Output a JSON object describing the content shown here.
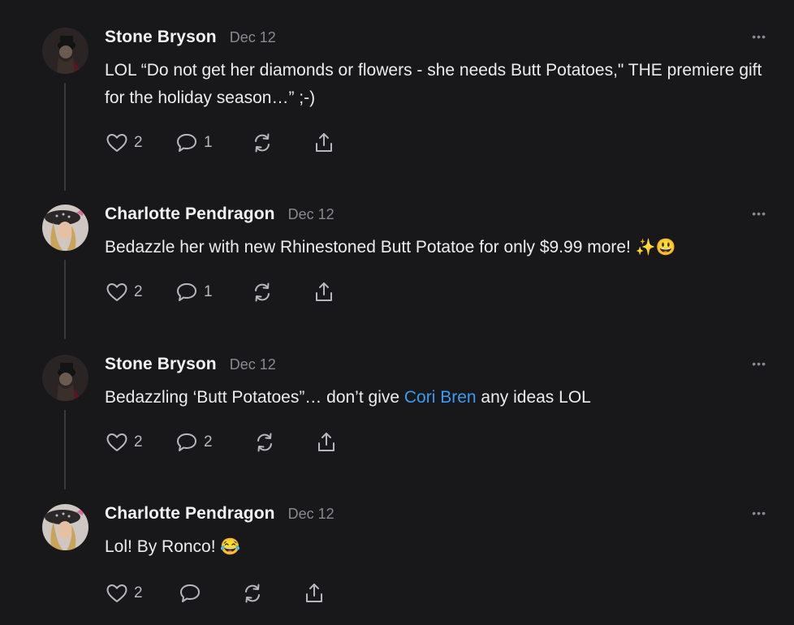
{
  "comments": [
    {
      "author": "Stone Bryson",
      "date": "Dec 12",
      "more": "•••",
      "text": "LOL “Do not get her diamonds or flowers - she needs Butt Potatoes,\" THE premiere gift for the holiday season…” ;-)",
      "likes": "2",
      "replies": "1"
    },
    {
      "author": "Charlotte Pendragon",
      "date": "Dec 12",
      "more": "•••",
      "text": "Bedazzle her with new Rhinestoned Butt Potatoe for only $9.99 more!",
      "emoji": "✨😃",
      "likes": "2",
      "replies": "1"
    },
    {
      "author": "Stone Bryson",
      "date": "Dec 12",
      "more": "•••",
      "text_before": "Bedazzling ‘Butt Potatoes”… don’t give ",
      "mention": "Cori Bren",
      "text_after": " any ideas LOL",
      "likes": "2",
      "replies": "2"
    },
    {
      "author": "Charlotte Pendragon",
      "date": "Dec 12",
      "more": "•••",
      "text": "Lol! By Ronco!",
      "emoji": "😂",
      "likes": "2",
      "replies": ""
    }
  ],
  "icons": {
    "like": "heart-icon",
    "reply": "comment-bubble-icon",
    "restack": "restack-icon",
    "share": "share-icon",
    "more": "more-options-icon"
  },
  "colors": {
    "background": "#18181a",
    "mention": "#3a9cf0",
    "muted": "#8a8a8e"
  }
}
